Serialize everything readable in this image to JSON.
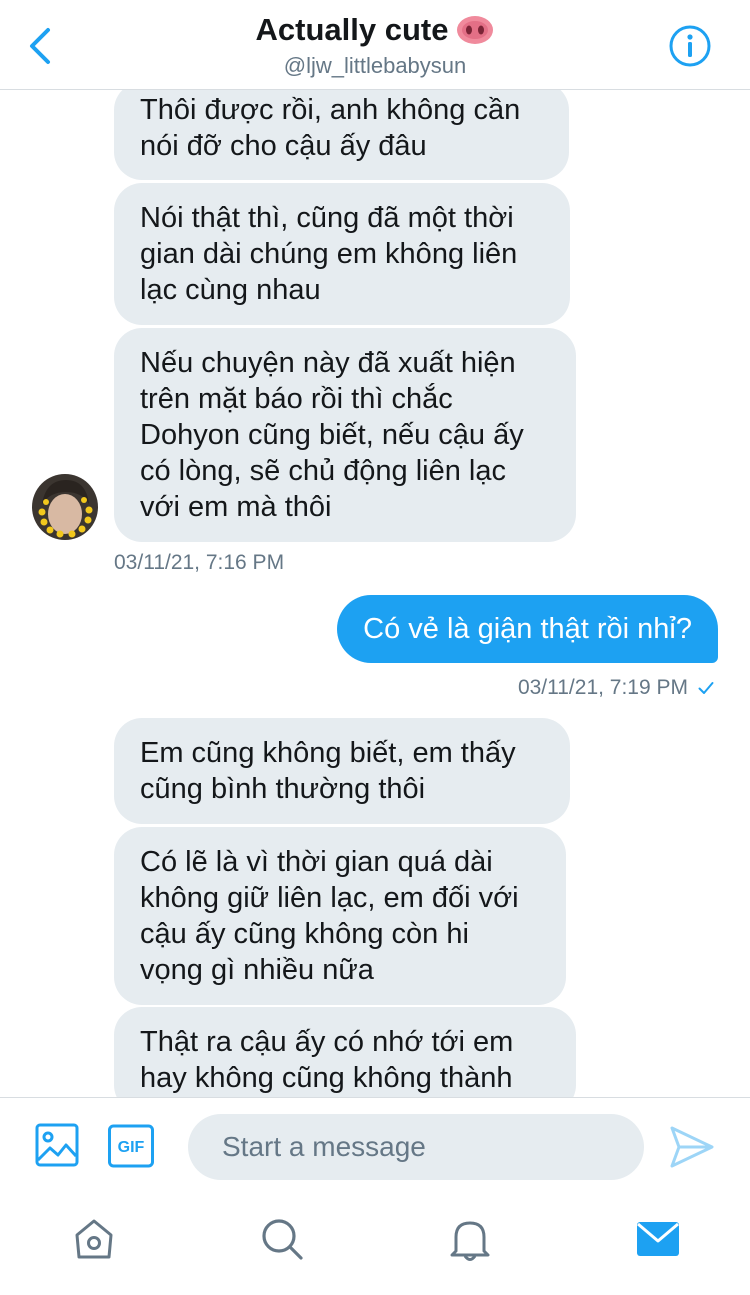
{
  "header": {
    "title": "Actually cute",
    "handle": "@ljw_littlebabysun",
    "title_emoji": "pig-nose-emoji"
  },
  "messages": {
    "incoming_group_1": [
      [
        "Thôi được rồi, anh không cần",
        "nói đỡ cho cậu ấy đâu"
      ],
      [
        "Nói thật thì, cũng đã một thời",
        "gian dài chúng em không liên",
        "lạc cùng nhau"
      ],
      [
        "Nếu chuyện này đã xuất hiện",
        "trên mặt báo rồi thì chắc",
        "Dohyon cũng biết, nếu cậu ấy",
        "có lòng, sẽ chủ động liên lạc",
        "với em mà thôi"
      ]
    ],
    "timestamp_1": "03/11/21, 7:16 PM",
    "outgoing_1": "Có vẻ là giận thật rồi nhỉ?",
    "timestamp_2": "03/11/21, 7:19 PM",
    "incoming_group_2": [
      [
        "Em cũng không biết, em thấy",
        "cũng bình thường thôi"
      ],
      [
        "Có lẽ là vì thời gian quá dài",
        "không giữ liên lạc, em đối với",
        "cậu ấy cũng không còn hi",
        "vọng gì nhiều nữa"
      ],
      [
        "Thật ra cậu ấy có nhớ tới em",
        "hay không cũng không thành"
      ]
    ]
  },
  "composer": {
    "placeholder": "Start a message",
    "gif_label": "GIF"
  },
  "icons": [
    "back-arrow-icon",
    "info-icon",
    "image-icon",
    "gif-icon",
    "send-icon",
    "home-icon",
    "search-icon",
    "bell-icon",
    "mail-icon"
  ],
  "colors": {
    "accent": "#1da1f2",
    "bubble_in": "#e6ecf0",
    "secondary_text": "#657786"
  }
}
